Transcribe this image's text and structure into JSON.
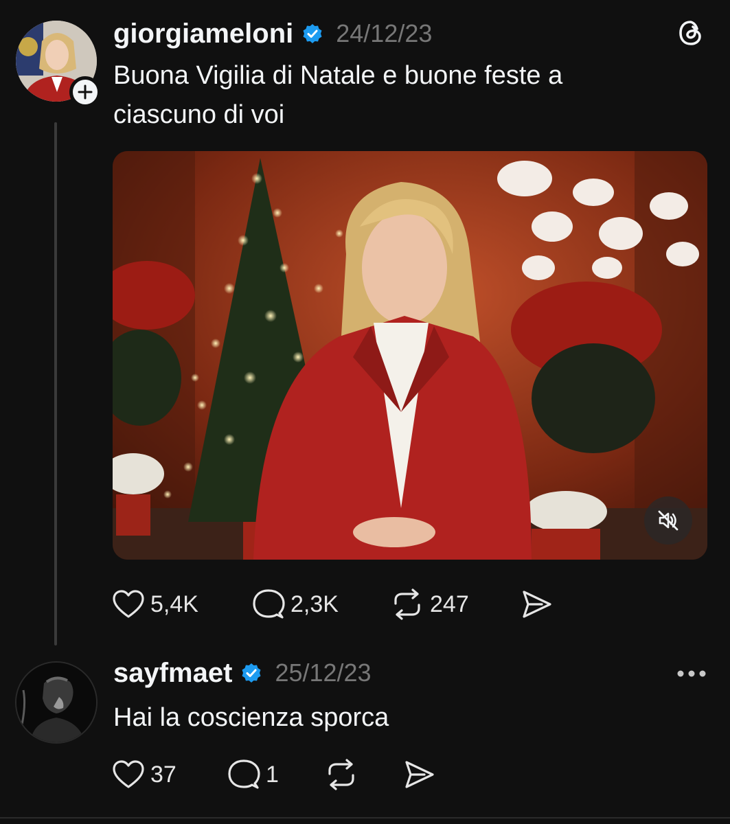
{
  "post": {
    "username": "giorgiameloni",
    "date": "24/12/23",
    "text_line1": "Buona Vigilia di Natale e buone feste a",
    "text_line2": "ciascuno di voi",
    "actions": {
      "likes": "5,4K",
      "comments": "2,3K",
      "reposts": "247"
    }
  },
  "reply": {
    "username": "sayfmaet",
    "date": "25/12/23",
    "text": "Hai la coscienza sporca",
    "actions": {
      "likes": "37",
      "comments": "1"
    }
  },
  "icons": {
    "verified": "verified-badge-icon",
    "app": "threads-logo-icon",
    "mute": "muted-speaker-icon"
  },
  "colors": {
    "background": "#101010",
    "verified": "#1d9bf0",
    "muted_text": "#777777",
    "jacket": "#b0221f"
  }
}
